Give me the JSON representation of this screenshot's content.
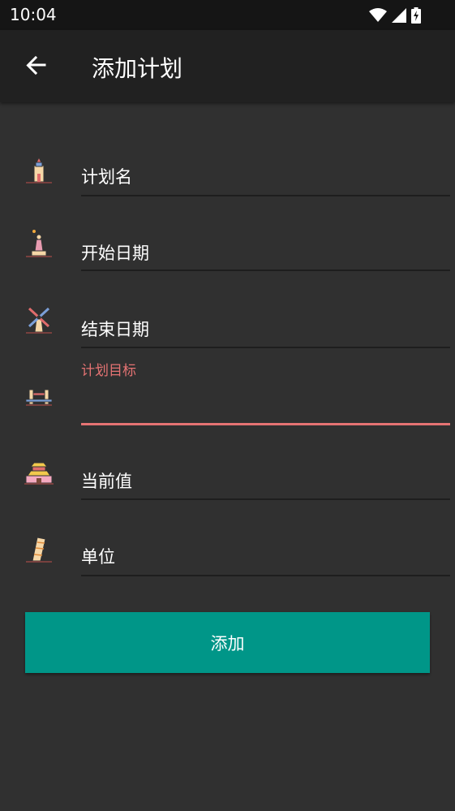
{
  "status_bar": {
    "time": "10:04"
  },
  "app_bar": {
    "title": "添加计划"
  },
  "form": {
    "plan_name": {
      "placeholder": "计划名"
    },
    "start_date": {
      "placeholder": "开始日期"
    },
    "end_date": {
      "placeholder": "结束日期"
    },
    "plan_target": {
      "label": "计划目标",
      "value": ""
    },
    "current_value": {
      "placeholder": "当前值"
    },
    "unit": {
      "placeholder": "单位"
    }
  },
  "add_button": {
    "label": "添加"
  },
  "colors": {
    "accent": "#009688",
    "error": "#e57373",
    "background": "#303030",
    "app_bar": "#212121"
  }
}
